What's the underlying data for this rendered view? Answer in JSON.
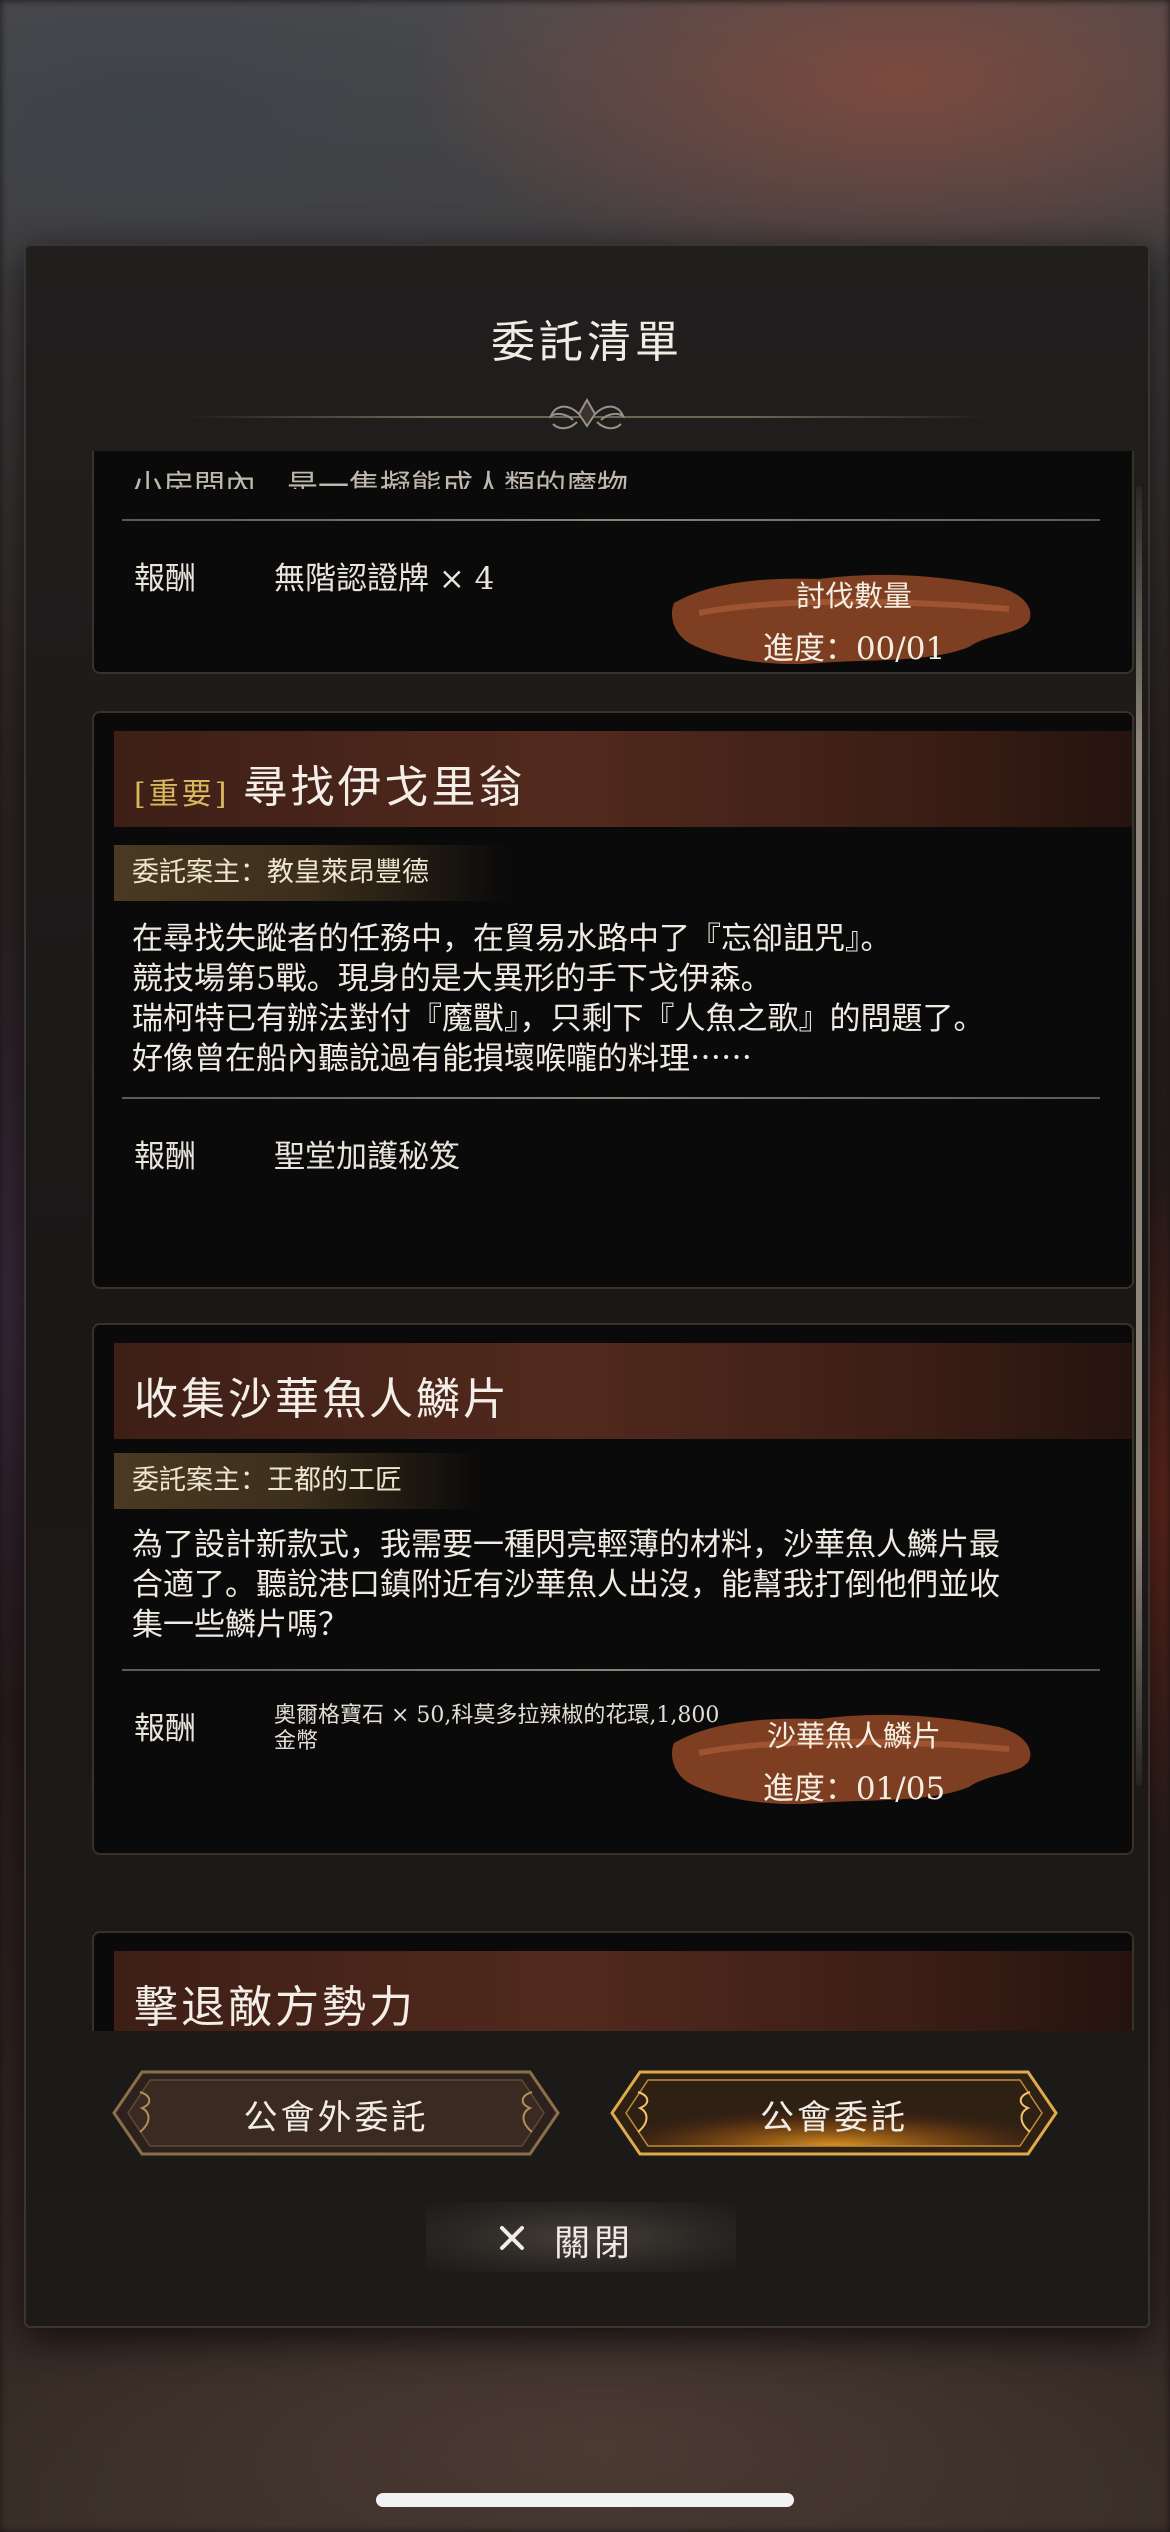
{
  "modal": {
    "title": "委託清單",
    "close_label": "關閉"
  },
  "quests": [
    {
      "partial_text": "小房間內，是一隻擬態成人類的魔物。",
      "reward_label": "報酬",
      "reward": "無階認證牌 × 4",
      "progress_name": "討伐數量",
      "progress_label": "進度：",
      "progress_value": "00/01",
      "progress_fraction": 0.0
    },
    {
      "tag": "[重要]",
      "title": "尋找伊戈里翁",
      "client": "委託案主：教皇萊昂豐德",
      "description": [
        "在尋找失蹤者的任務中，在貿易水路中了『忘卻詛咒』。",
        "競技場第5戰。現身的是大異形的手下戈伊森。",
        "瑞柯特已有辦法對付『魔獸』，只剩下『人魚之歌』的問題了。",
        "好像曾在船內聽說過有能損壞喉嚨的料理⋯⋯"
      ],
      "reward_label": "報酬",
      "reward": "聖堂加護秘笈"
    },
    {
      "title": "收集沙華魚人鱗片",
      "client": "委託案主：王都的工匠",
      "description": [
        "為了設計新款式，我需要一種閃亮輕薄的材料，沙華魚人鱗片最",
        "合適了。聽說港口鎮附近有沙華魚人出沒，能幫我打倒他們並收",
        "集一些鱗片嗎？"
      ],
      "reward_label": "報酬",
      "reward_line1": "奧爾格寶石 × 50,科莫多拉辣椒的花環,1,800",
      "reward_line2": "金幣",
      "progress_name": "沙華魚人鱗片",
      "progress_label": "進度：",
      "progress_value": "01/05",
      "progress_fraction": 0.2
    },
    {
      "title": "擊退敵方勢力"
    }
  ],
  "tabs": [
    {
      "label": "公會外委託",
      "active": false
    },
    {
      "label": "公會委託",
      "active": true
    }
  ],
  "colors": {
    "accent_gold": "#d9b75f",
    "active_glow": "#f0a020",
    "card_header": "#52291d",
    "brush_stroke": "#9a4e28"
  },
  "icons": [
    "ornament-icon",
    "brush-stroke-icon",
    "close-icon",
    "corner-flourish-icon"
  ]
}
